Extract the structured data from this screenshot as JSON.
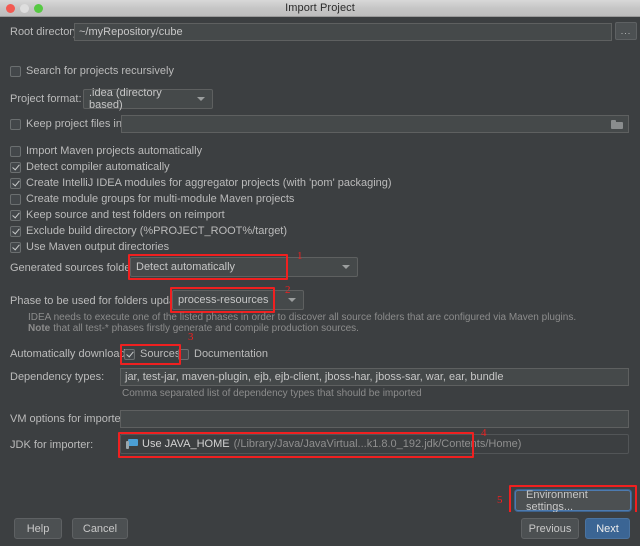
{
  "window": {
    "title": "Import Project",
    "controls": [
      "close",
      "minimize",
      "zoom"
    ]
  },
  "fields": {
    "root_directory": {
      "label": "Root directory",
      "value": "~/myRepository/cube",
      "browse_label": "..."
    },
    "search_recursively": {
      "label": "Search for projects recursively",
      "checked": false
    },
    "project_format": {
      "label": "Project format:",
      "value": ".idea (directory based)"
    },
    "keep_project_files": {
      "label": "Keep project files in:",
      "checked": false,
      "value": "",
      "icon": "folder-icon"
    }
  },
  "options": [
    {
      "label": "Import Maven projects automatically",
      "checked": false
    },
    {
      "label": "Detect compiler automatically",
      "checked": true
    },
    {
      "label": "Create IntelliJ IDEA modules for aggregator projects (with 'pom' packaging)",
      "checked": true
    },
    {
      "label": "Create module groups for multi-module Maven projects",
      "checked": false
    },
    {
      "label": "Keep source and test folders on reimport",
      "checked": true
    },
    {
      "label": "Exclude build directory (%PROJECT_ROOT%/target)",
      "checked": true
    },
    {
      "label": "Use Maven output directories",
      "checked": true
    }
  ],
  "generated_sources": {
    "label": "Generated sources folders:",
    "value": "Detect automatically"
  },
  "phase": {
    "label": "Phase to be used for folders update:",
    "value": "process-resources",
    "hint_line1": "IDEA needs to execute one of the listed phases in order to discover all source folders that are configured via Maven plugins.",
    "hint_line2_bold": "Note",
    "hint_line2": "that all test-* phases firstly generate and compile production sources."
  },
  "auto_download": {
    "label": "Automatically download:",
    "sources": {
      "label": "Sources",
      "checked": true
    },
    "documentation": {
      "label": "Documentation",
      "checked": false
    }
  },
  "dependency_types": {
    "label": "Dependency types:",
    "value": "jar, test-jar, maven-plugin, ejb, ejb-client, jboss-har, jboss-sar, war, ear, bundle",
    "hint": "Comma separated list of dependency types that should be imported"
  },
  "vm_options": {
    "label": "VM options for importer:",
    "value": ""
  },
  "jdk": {
    "label": "JDK for importer:",
    "icon": "jdk-icon",
    "value": "Use JAVA_HOME",
    "path": "(/Library/Java/JavaVirtual...k1.8.0_192.jdk/Contents/Home)"
  },
  "environment_settings_button": "Environment settings...",
  "buttons": {
    "help": "Help",
    "cancel": "Cancel",
    "previous": "Previous",
    "next": "Next"
  },
  "annotations": [
    {
      "number": "1"
    },
    {
      "number": "2"
    },
    {
      "number": "3"
    },
    {
      "number": "4"
    },
    {
      "number": "5"
    }
  ],
  "colors": {
    "annotation_red": "#f02020",
    "default_button_blue": "#3b6594",
    "background": "#3c3f41"
  }
}
